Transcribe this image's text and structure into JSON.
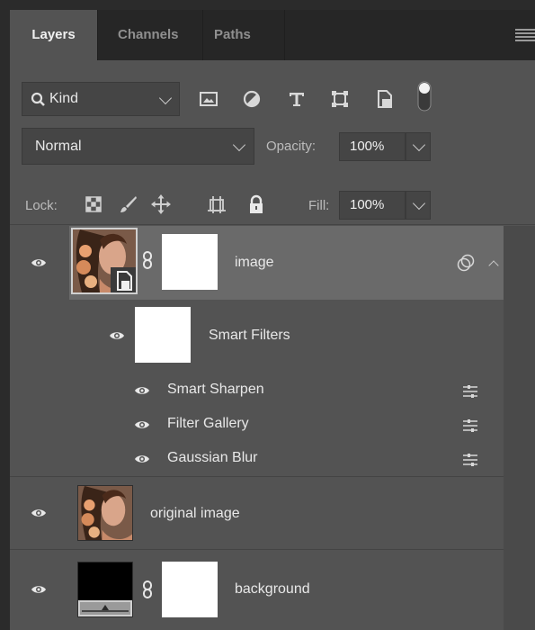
{
  "tabs": [
    {
      "label": "Layers"
    },
    {
      "label": "Channels"
    },
    {
      "label": "Paths"
    }
  ],
  "filter": {
    "kind_label": "Kind",
    "filter_icons": [
      "image-filter-icon",
      "adjustment-filter-icon",
      "type-filter-icon",
      "shape-filter-icon",
      "smart-object-filter-icon",
      "filter-toggle-icon"
    ]
  },
  "blend": {
    "mode": "Normal",
    "opacity_label": "Opacity:",
    "opacity_value": "100%"
  },
  "lock": {
    "label": "Lock:",
    "fill_label": "Fill:",
    "fill_value": "100%"
  },
  "layers": {
    "image": {
      "name": "image",
      "smart_filters_label": "Smart Filters",
      "filters": [
        {
          "name": "Smart Sharpen"
        },
        {
          "name": "Filter Gallery"
        },
        {
          "name": "Gaussian Blur"
        }
      ]
    },
    "original": {
      "name": "original image"
    },
    "background": {
      "name": "background"
    }
  },
  "colors": {
    "panel_bg": "#535353",
    "selected_row": "#6a6a6a",
    "tab_bar": "#262626",
    "control_bg": "#454545"
  }
}
